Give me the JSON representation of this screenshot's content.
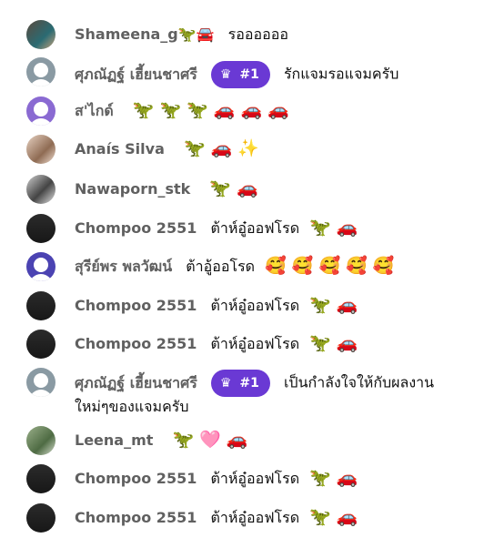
{
  "messages": [
    {
      "author": "Shameena_g🦖🚘",
      "text": "รออออออ",
      "emoji": ""
    },
    {
      "author": "ศุภณัฏฐ์ เฮี้ยนชาศรี",
      "badge": "#1",
      "text": "รักแจมรอแจมครับ",
      "emoji": ""
    },
    {
      "author": "ส'ไกด์",
      "text": "",
      "emoji": "🦖🦖🦖🚗🚗🚗"
    },
    {
      "author": "Anaís Silva",
      "text": "",
      "emoji": "🦖🚗✨"
    },
    {
      "author": "Nawaporn_stk",
      "text": "",
      "emoji": "🦖🚗"
    },
    {
      "author": "Chompoo 2551",
      "text": "ต้าห์อู๋ออฟโรด",
      "emoji": "🦖🚗"
    },
    {
      "author": "สุรีย์พร พลวัฒน์",
      "text": "ต้าอู้ออโรด",
      "emoji": "🥰🥰🥰🥰🥰"
    },
    {
      "author": "Chompoo 2551",
      "text": "ต้าห์อู๋ออฟโรด",
      "emoji": "🦖🚗"
    },
    {
      "author": "Chompoo 2551",
      "text": "ต้าห์อู๋ออฟโรด",
      "emoji": "🦖🚗"
    },
    {
      "author": "ศุภณัฏฐ์ เฮี้ยนชาศรี",
      "badge": "#1",
      "text": "เป็นกำลังใจให้กับผลงานใหม่ๆของแจมครับ",
      "emoji": ""
    },
    {
      "author": "Leena_mt",
      "text": "",
      "emoji": "🦖🩷🚗"
    },
    {
      "author": "Chompoo 2551",
      "text": "ต้าห์อู๋ออฟโรด",
      "emoji": "🦖🚗"
    },
    {
      "author": "Chompoo 2551",
      "text": "ต้าห์อู๋ออฟโรด",
      "emoji": "🦖🚗"
    }
  ]
}
